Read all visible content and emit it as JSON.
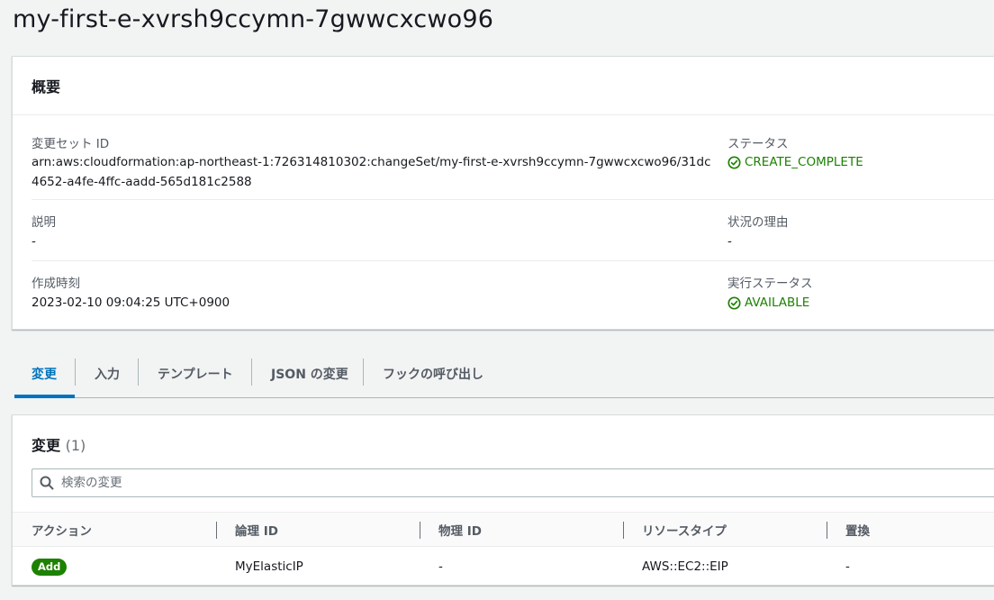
{
  "page": {
    "title": "my-first-e-xvrsh9ccymn-7gwwcxcwo96"
  },
  "overview": {
    "heading": "概要",
    "changeset_id_label": "変更セット ID",
    "changeset_id_value": "arn:aws:cloudformation:ap-northeast-1:726314810302:changeSet/my-first-e-xvrsh9ccymn-7gwwcxcwo96/31dc4652-a4fe-4ffc-aadd-565d181c2588",
    "status_label": "ステータス",
    "status_value": "CREATE_COMPLETE",
    "description_label": "説明",
    "description_value": "-",
    "status_reason_label": "状況の理由",
    "status_reason_value": "-",
    "created_label": "作成時刻",
    "created_value": "2023-02-10 09:04:25 UTC+0900",
    "exec_status_label": "実行ステータス",
    "exec_status_value": "AVAILABLE"
  },
  "tabs": [
    {
      "label": "変更"
    },
    {
      "label": "入力"
    },
    {
      "label": "テンプレート"
    },
    {
      "label": "JSON の変更"
    },
    {
      "label": "フックの呼び出し"
    }
  ],
  "changes": {
    "heading": "変更",
    "count": "(1)",
    "search_placeholder": "検索の変更",
    "columns": [
      "アクション",
      "論理 ID",
      "物理 ID",
      "リソースタイプ",
      "置換"
    ],
    "rows": [
      {
        "action": "Add",
        "logical_id": "MyElasticIP",
        "physical_id": "-",
        "resource_type": "AWS::EC2::EIP",
        "replacement": "-"
      }
    ]
  },
  "colors": {
    "success": "#1d8102",
    "accent": "#0073bb"
  }
}
